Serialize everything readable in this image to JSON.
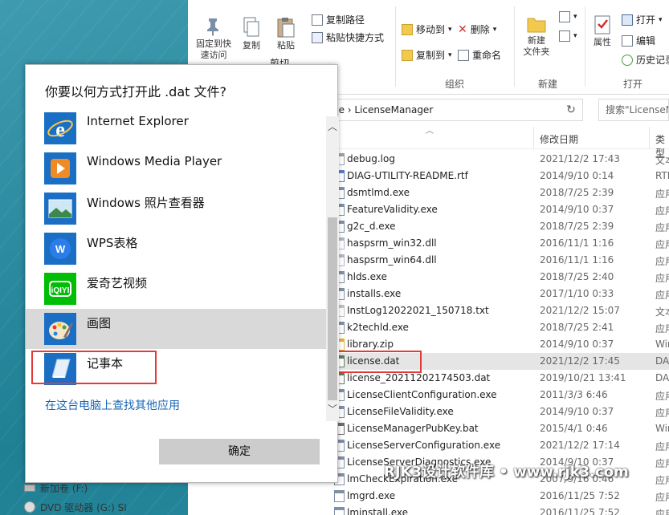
{
  "ribbon": {
    "pin_label": "固定到快\n速访问",
    "copy_label": "复制",
    "paste_label": "粘贴",
    "copy_path_label": "复制路径",
    "paste_shortcut_label": "粘贴快捷方式",
    "cut_label": "剪切",
    "move_to_label": "移动到",
    "delete_label": "删除",
    "copy_to_label": "复制到",
    "rename_label": "重命名",
    "new_folder_label": "新建\n文件夹",
    "properties_label": "属性",
    "open_label": "打开",
    "edit_label": "编辑",
    "history_label": "历史记录",
    "group_organize": "组织",
    "group_new": "新建",
    "group_open": "打开"
  },
  "address": {
    "path": "ce  ›  LicenseManager",
    "search_placeholder": "搜索\"LicenseManager\""
  },
  "file_list": {
    "col_date": "修改日期",
    "col_type": "类型",
    "files": [
      {
        "name": "debug.log",
        "date": "2021/12/2 17:43",
        "type": "文本",
        "icon": "log-icon"
      },
      {
        "name": "DIAG-UTILITY-README.rtf",
        "date": "2014/9/10 0:14",
        "type": "RTF",
        "icon": "rtf-icon"
      },
      {
        "name": "dsmtlmd.exe",
        "date": "2018/7/25 2:39",
        "type": "应用",
        "icon": "exe-icon"
      },
      {
        "name": "FeatureValidity.exe",
        "date": "2014/9/10 0:37",
        "type": "应用",
        "icon": "exe-icon"
      },
      {
        "name": "g2c_d.exe",
        "date": "2018/7/25 2:39",
        "type": "应用",
        "icon": "exe-icon"
      },
      {
        "name": "haspsrm_win32.dll",
        "date": "2016/11/1 1:16",
        "type": "应用",
        "icon": "dll-icon"
      },
      {
        "name": "haspsrm_win64.dll",
        "date": "2016/11/1 1:16",
        "type": "应用",
        "icon": "dll-icon"
      },
      {
        "name": "hlds.exe",
        "date": "2018/7/25 2:40",
        "type": "应用",
        "icon": "exe-icon"
      },
      {
        "name": "installs.exe",
        "date": "2017/1/10 0:33",
        "type": "应用",
        "icon": "exe-icon"
      },
      {
        "name": "InstLog12022021_150718.txt",
        "date": "2021/12/2 15:07",
        "type": "文本",
        "icon": "txt-icon"
      },
      {
        "name": "k2techld.exe",
        "date": "2018/7/25 2:41",
        "type": "应用",
        "icon": "exe-icon"
      },
      {
        "name": "library.zip",
        "date": "2014/9/10 0:37",
        "type": "Win",
        "icon": "zip-icon"
      },
      {
        "name": "license.dat",
        "date": "2021/12/2 17:45",
        "type": "DA",
        "icon": "dat-icon",
        "selected": true
      },
      {
        "name": "license_20211202174503.dat",
        "date": "2019/10/21 13:41",
        "type": "DA",
        "icon": "dat-icon"
      },
      {
        "name": "LicenseClientConfiguration.exe",
        "date": "2011/3/3 6:46",
        "type": "应用",
        "icon": "exe-icon"
      },
      {
        "name": "LicenseFileValidity.exe",
        "date": "2014/9/10 0:37",
        "type": "应用",
        "icon": "exe-icon"
      },
      {
        "name": "LicenseManagerPubKey.bat",
        "date": "2015/4/1 0:46",
        "type": "Win",
        "icon": "bat-icon"
      },
      {
        "name": "LicenseServerConfiguration.exe",
        "date": "2021/12/2 17:14",
        "type": "应用",
        "icon": "exe-icon"
      },
      {
        "name": "LicenseServerDiagnostics.exe",
        "date": "2014/9/10 0:37",
        "type": "应用",
        "icon": "exe-icon"
      },
      {
        "name": "lmCheckExpiration.exe",
        "date": "2007/9/16 0:46",
        "type": "应用",
        "icon": "exe-icon"
      },
      {
        "name": "lmgrd.exe",
        "date": "2016/11/25 7:52",
        "type": "应用",
        "icon": "exe-icon"
      },
      {
        "name": "lminstall.exe",
        "date": "2016/11/25 7:52",
        "type": "应用",
        "icon": "exe-icon"
      }
    ]
  },
  "nav": {
    "items": [
      {
        "label": "新加卷 (F:)",
        "icon": "drive-icon"
      },
      {
        "label": "DVD 驱动器 (G:) SI",
        "icon": "dvd-icon"
      }
    ]
  },
  "dialog": {
    "title": "你要以何方式打开此 .dat 文件?",
    "apps": [
      {
        "label": "Internet Explorer",
        "icon": "internet-explorer-icon"
      },
      {
        "label": "Windows Media Player",
        "icon": "windows-media-player-icon"
      },
      {
        "label": "Windows 照片查看器",
        "icon": "photo-viewer-icon"
      },
      {
        "label": "WPS表格",
        "icon": "wps-spreadsheet-icon"
      },
      {
        "label": "爱奇艺视频",
        "icon": "iqiyi-icon"
      },
      {
        "label": "画图",
        "icon": "paint-icon",
        "selected": true
      },
      {
        "label": "记事本",
        "icon": "notepad-icon"
      }
    ],
    "more_apps_link": "在这台电脑上查找其他应用",
    "ok_label": "确定"
  },
  "watermark": "RJK3设计软件库 • www.rjk3.com",
  "colors": {
    "highlight_red": "#e23b3b",
    "link_blue": "#1a68b8",
    "selected_row": "#e5e5e5"
  }
}
